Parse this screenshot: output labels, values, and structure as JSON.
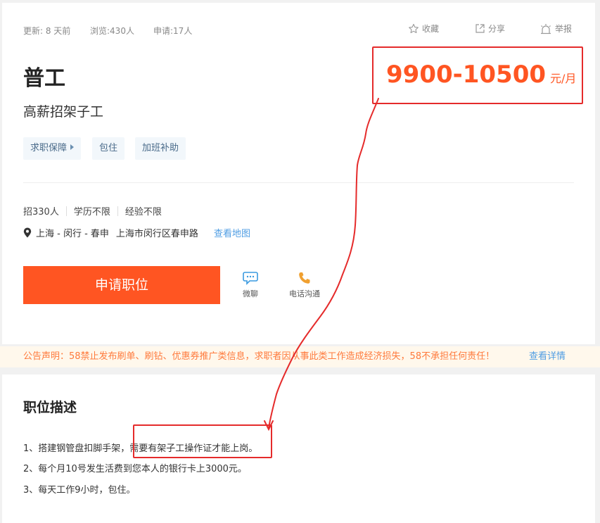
{
  "meta": {
    "updated": "更新: 8 天前",
    "views": "浏览:430人",
    "applies": "申请:17人"
  },
  "actions": {
    "favorite": "收藏",
    "share": "分享",
    "report": "举报"
  },
  "job": {
    "title": "普工",
    "subtitle": "高薪招架子工",
    "tags": [
      "求职保障",
      "包住",
      "加班补助"
    ],
    "salary": "9900-10500",
    "salary_unit": "元/月"
  },
  "requirements": {
    "headcount": "招330人",
    "education": "学历不限",
    "experience": "经验不限"
  },
  "location": {
    "area": "上海 - 闵行 - 春申",
    "address": "上海市闵行区春申路",
    "map_link": "查看地图"
  },
  "buttons": {
    "apply": "申请职位",
    "chat": "微聊",
    "phone": "电话沟通"
  },
  "notice": {
    "text": "公告声明：58禁止发布刷单、刷钻、优惠券推广类信息，求职者因从事此类工作造成经济损失，58不承担任何责任！",
    "more": "查看详情"
  },
  "description": {
    "title": "职位描述",
    "line1_a": "1、搭建钢管盘扣脚手架，",
    "line1_b": "需要有架子工操作证才能上岗。",
    "line2": "2、每个月10号发生活费到您本人的银行卡上3000元。",
    "line3": "3、每天工作9小时，包住。"
  },
  "colors": {
    "accent": "#ff5522",
    "link": "#4f9de3",
    "annotation": "#e52b2b"
  }
}
